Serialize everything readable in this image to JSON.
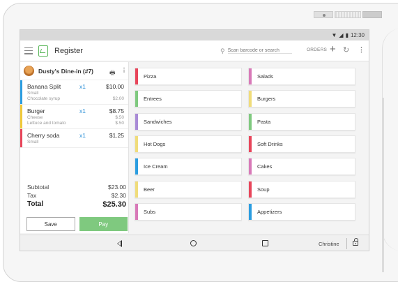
{
  "status_bar": {
    "time": "12:30"
  },
  "app": {
    "title": "Register"
  },
  "search": {
    "placeholder": "Scan barcode or search"
  },
  "header_actions": {
    "orders_label": "ORDERS"
  },
  "order": {
    "name": "Dusty's Dine-in (#7)",
    "items": [
      {
        "name": "Banana Split",
        "qty": "x1",
        "price": "$10.00",
        "color": "#2b9de0",
        "modifiers": [
          {
            "name": "Small",
            "price": ""
          },
          {
            "name": "Chocolate syrup",
            "price": "$2.00"
          }
        ]
      },
      {
        "name": "Burger",
        "qty": "x1",
        "price": "$8.75",
        "color": "#f0c93a",
        "modifiers": [
          {
            "name": "Cheese",
            "price": "$.50"
          },
          {
            "name": "Lettuce and tomato",
            "price": "$.50"
          }
        ]
      },
      {
        "name": "Cherry soda",
        "qty": "x1",
        "price": "$1.25",
        "color": "#e8455a",
        "modifiers": [
          {
            "name": "Small",
            "price": ""
          }
        ]
      }
    ],
    "subtotal_label": "Subtotal",
    "subtotal": "$23.00",
    "tax_label": "Tax",
    "tax": "$2.30",
    "total_label": "Total",
    "total": "$25.30",
    "save_label": "Save",
    "pay_label": "Pay"
  },
  "categories": [
    {
      "name": "Pizza",
      "color": "#e8455a"
    },
    {
      "name": "Salads",
      "color": "#d879b8"
    },
    {
      "name": "Entrees",
      "color": "#7fc97f"
    },
    {
      "name": "Burgers",
      "color": "#f0dc7a"
    },
    {
      "name": "Sandwiches",
      "color": "#a98bd6"
    },
    {
      "name": "Pasta",
      "color": "#7fc97f"
    },
    {
      "name": "Hot Dogs",
      "color": "#f0dc7a"
    },
    {
      "name": "Soft Drinks",
      "color": "#e8455a"
    },
    {
      "name": "Ice Cream",
      "color": "#2b9de0"
    },
    {
      "name": "Cakes",
      "color": "#d879b8"
    },
    {
      "name": "Beer",
      "color": "#f0dc7a"
    },
    {
      "name": "Soup",
      "color": "#e8455a"
    },
    {
      "name": "Subs",
      "color": "#d879b8"
    },
    {
      "name": "Appetizers",
      "color": "#2b9de0"
    }
  ],
  "nav": {
    "user": "Christine"
  }
}
